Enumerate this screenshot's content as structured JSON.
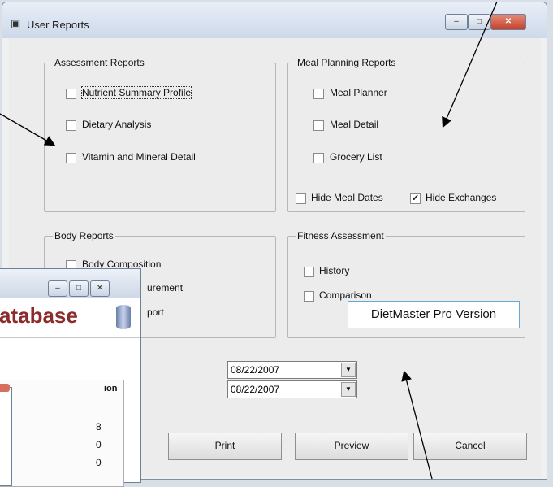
{
  "window": {
    "title": "User Reports"
  },
  "assessment": {
    "legend": "Assessment Reports",
    "items": [
      {
        "label": "Nutrient Summary Profile",
        "checked": false
      },
      {
        "label": "Dietary Analysis",
        "checked": false
      },
      {
        "label": "Vitamin and Mineral Detail",
        "checked": false
      }
    ]
  },
  "meal": {
    "legend": "Meal Planning Reports",
    "items": [
      {
        "label": "Meal Planner",
        "checked": false
      },
      {
        "label": "Meal Detail",
        "checked": false
      },
      {
        "label": "Grocery List",
        "checked": false
      }
    ],
    "hide_dates": {
      "label": "Hide Meal Dates",
      "checked": false
    },
    "hide_exchanges": {
      "label": "Hide Exchanges",
      "checked": true
    }
  },
  "body": {
    "legend": "Body Reports",
    "items": [
      {
        "label": "Body Composition",
        "checked": false
      },
      {
        "label": "urement",
        "checked": false
      },
      {
        "label": "port",
        "checked": false
      }
    ]
  },
  "fitness": {
    "legend": "Fitness Assessment",
    "items": [
      {
        "label": "History",
        "checked": false
      },
      {
        "label": "Comparison",
        "checked": false
      }
    ]
  },
  "callout": "DietMaster Pro Version",
  "dates": {
    "from": "08/22/2007",
    "to": "08/22/2007"
  },
  "buttons": {
    "print": "Print",
    "preview": "Preview",
    "cancel": "Cancel"
  },
  "bg_window": {
    "title": "atabase",
    "column_header": "ion",
    "values": [
      "8",
      "0",
      "0"
    ]
  }
}
